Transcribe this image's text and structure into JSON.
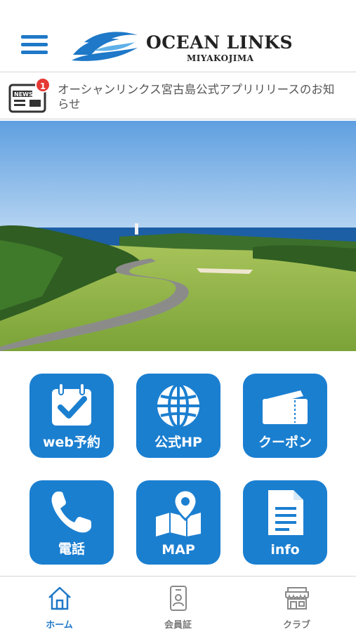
{
  "header": {
    "logo_title": "OCEAN LINKS",
    "logo_subtitle": "MIYAKOJIMA"
  },
  "news": {
    "badge_count": "1",
    "icon_label": "NEWS",
    "text": "オーシャンリンクス宮古島公式アプリリリースのお知らせ"
  },
  "tiles": [
    {
      "label": "web予約",
      "icon": "calendar-check-icon"
    },
    {
      "label": "公式HP",
      "icon": "globe-icon"
    },
    {
      "label": "クーポン",
      "icon": "ticket-icon"
    },
    {
      "label": "電話",
      "icon": "phone-icon"
    },
    {
      "label": "MAP",
      "icon": "map-pin-icon"
    },
    {
      "label": "info",
      "icon": "document-icon"
    }
  ],
  "bottom_nav": [
    {
      "label": "ホーム",
      "icon": "home-icon",
      "active": true
    },
    {
      "label": "会員証",
      "icon": "member-card-icon",
      "active": false
    },
    {
      "label": "クラブ",
      "icon": "shop-icon",
      "active": false
    }
  ],
  "colors": {
    "accent": "#1f78c8",
    "tile": "#1b7fd0",
    "badge": "#e53935"
  }
}
